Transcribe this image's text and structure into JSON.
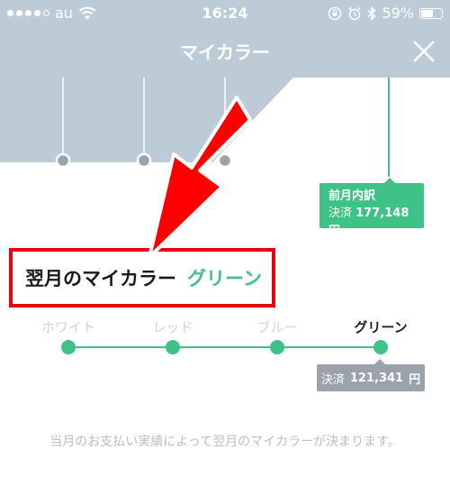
{
  "status_bar": {
    "carrier": "au",
    "time": "16:24",
    "battery": "59%",
    "battery_level": 0.59,
    "signal_bars": 4,
    "icons": [
      "wifi-icon",
      "rotation-lock-icon",
      "alarm-icon",
      "bluetooth-icon"
    ]
  },
  "header": {
    "title": "マイカラー",
    "close_icon": "close-icon"
  },
  "prev_month": {
    "title": "前月内訳",
    "label": "決済",
    "amount": "177,148",
    "unit": "円"
  },
  "next_color": {
    "label": "翌月のマイカラー",
    "value": "グリーン"
  },
  "steps": {
    "items": [
      {
        "label": "ホワイト",
        "active": false
      },
      {
        "label": "レッド",
        "active": false
      },
      {
        "label": "ブルー",
        "active": false
      },
      {
        "label": "グリーン",
        "active": true
      }
    ]
  },
  "current": {
    "label": "決済",
    "amount": "121,341",
    "unit": "円"
  },
  "note": "当月のお支払い実績によって翌月のマイカラーが決まります。",
  "colors": {
    "header_bg": "#bccbd6",
    "accent_green": "#3fc285",
    "highlight_red": "#e60012",
    "muted_gray": "#9aa3ab"
  }
}
